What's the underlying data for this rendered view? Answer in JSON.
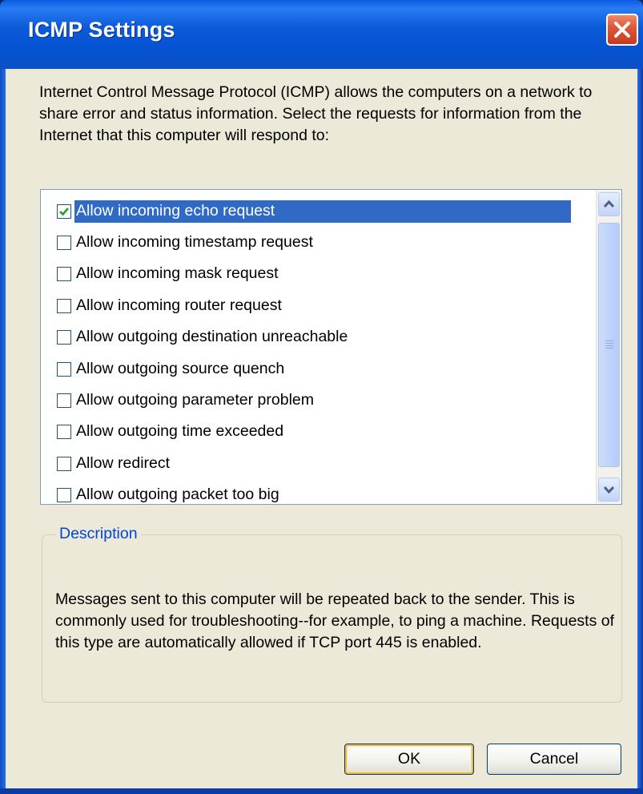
{
  "window": {
    "title": "ICMP Settings"
  },
  "intro_text": "Internet Control Message Protocol (ICMP) allows the computers on a network to share error and status information. Select the requests for information from the Internet that this computer will respond to:",
  "requests": [
    {
      "label": "Allow incoming echo request",
      "checked": true,
      "selected": true
    },
    {
      "label": "Allow incoming timestamp request",
      "checked": false,
      "selected": false
    },
    {
      "label": "Allow incoming mask request",
      "checked": false,
      "selected": false
    },
    {
      "label": "Allow incoming router request",
      "checked": false,
      "selected": false
    },
    {
      "label": "Allow outgoing destination unreachable",
      "checked": false,
      "selected": false
    },
    {
      "label": "Allow outgoing source quench",
      "checked": false,
      "selected": false
    },
    {
      "label": "Allow outgoing parameter problem",
      "checked": false,
      "selected": false
    },
    {
      "label": "Allow outgoing time exceeded",
      "checked": false,
      "selected": false
    },
    {
      "label": "Allow redirect",
      "checked": false,
      "selected": false
    },
    {
      "label": "Allow outgoing packet too big",
      "checked": false,
      "selected": false
    }
  ],
  "description": {
    "label": "Description",
    "text": "Messages sent to this computer will be repeated back to the sender. This is commonly used for troubleshooting--for example, to ping a machine. Requests of this type are automatically allowed if TCP port 445 is enabled."
  },
  "buttons": {
    "ok": "OK",
    "cancel": "Cancel"
  },
  "colors": {
    "titlebar": "#0553d3",
    "selection": "#316ac5",
    "dialog_face": "#ece9d8",
    "group_label": "#0046d5",
    "close_button": "#e0583a"
  },
  "icons": {
    "close": "close-icon",
    "scroll_up": "chevron-up-icon",
    "scroll_down": "chevron-down-icon",
    "check": "checkmark-icon"
  }
}
